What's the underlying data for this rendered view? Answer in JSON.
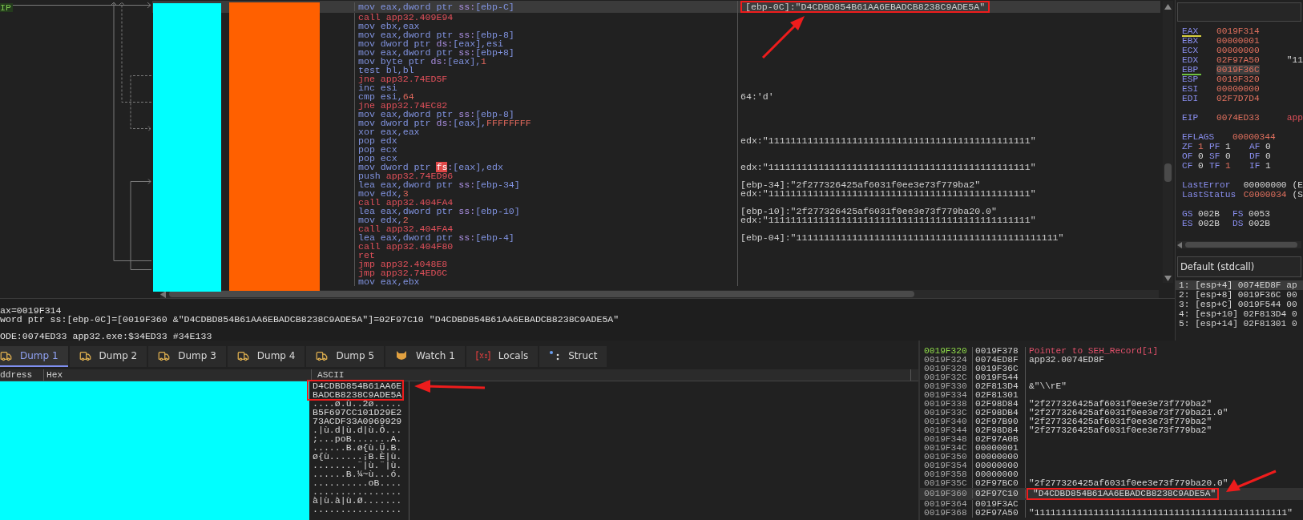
{
  "disassembly": {
    "eip_label": "IP",
    "rows": [
      {
        "mnemonic": "mov",
        "kind": "plain",
        "operands": [
          {
            "text": "eax,dword ptr ",
            "kind": "reg"
          },
          {
            "text": "ss:",
            "kind": "seg"
          },
          {
            "text": "[ebp-C]",
            "kind": "reg"
          }
        ],
        "comment": "[ebp-0C]:\"D4CDBD854B61AA6EBADCB8238C9ADE5A\"",
        "highlighted": true,
        "selected": true
      },
      {
        "mnemonic": "call",
        "kind": "branch",
        "operands": [
          {
            "text": "app32.409E94",
            "kind": "addr"
          }
        ],
        "highlighted": false,
        "selected": false
      },
      {
        "mnemonic": "mov",
        "kind": "plain",
        "operands": [
          {
            "text": "ebx,eax",
            "kind": "reg"
          }
        ],
        "highlighted": false,
        "selected": false
      },
      {
        "mnemonic": "mov",
        "kind": "plain",
        "operands": [
          {
            "text": "eax,dword ptr ",
            "kind": "reg"
          },
          {
            "text": "ss:",
            "kind": "seg"
          },
          {
            "text": "[ebp-8]",
            "kind": "reg"
          }
        ],
        "highlighted": false,
        "selected": false
      },
      {
        "mnemonic": "mov",
        "kind": "plain",
        "operands": [
          {
            "text": "dword ptr ",
            "kind": "reg"
          },
          {
            "text": "ds:",
            "kind": "seg"
          },
          {
            "text": "[eax],esi",
            "kind": "reg"
          }
        ],
        "highlighted": false,
        "selected": false
      },
      {
        "mnemonic": "mov",
        "kind": "plain",
        "operands": [
          {
            "text": "eax,dword ptr ",
            "kind": "reg"
          },
          {
            "text": "ss:",
            "kind": "seg"
          },
          {
            "text": "[ebp+8]",
            "kind": "reg"
          }
        ],
        "highlighted": false,
        "selected": false
      },
      {
        "mnemonic": "mov",
        "kind": "plain",
        "operands": [
          {
            "text": "byte ptr ",
            "kind": "reg"
          },
          {
            "text": "ds:",
            "kind": "seg"
          },
          {
            "text": "[eax],",
            "kind": "reg"
          },
          {
            "text": "1",
            "kind": "imm"
          }
        ],
        "highlighted": false,
        "selected": false
      },
      {
        "mnemonic": "test",
        "kind": "plain",
        "operands": [
          {
            "text": "bl,bl",
            "kind": "reg"
          }
        ],
        "highlighted": false,
        "selected": false
      },
      {
        "mnemonic": "jne",
        "kind": "branch",
        "operands": [
          {
            "text": "app32.74ED5F",
            "kind": "addr"
          }
        ],
        "highlighted": false,
        "selected": false
      },
      {
        "mnemonic": "inc",
        "kind": "plain",
        "operands": [
          {
            "text": "esi",
            "kind": "reg"
          }
        ],
        "highlighted": false,
        "selected": false
      },
      {
        "mnemonic": "cmp",
        "kind": "plain",
        "operands": [
          {
            "text": "esi,",
            "kind": "reg"
          },
          {
            "text": "64",
            "kind": "imm"
          }
        ],
        "comment": "64:'d'",
        "highlighted": false,
        "selected": false
      },
      {
        "mnemonic": "jne",
        "kind": "branch",
        "operands": [
          {
            "text": "app32.74EC82",
            "kind": "addr"
          }
        ],
        "highlighted": false,
        "selected": false
      },
      {
        "mnemonic": "mov",
        "kind": "plain",
        "operands": [
          {
            "text": "eax,dword ptr ",
            "kind": "reg"
          },
          {
            "text": "ss:",
            "kind": "seg"
          },
          {
            "text": "[ebp-8]",
            "kind": "reg"
          }
        ],
        "highlighted": false,
        "selected": false
      },
      {
        "mnemonic": "mov",
        "kind": "plain",
        "operands": [
          {
            "text": "dword ptr ",
            "kind": "reg"
          },
          {
            "text": "ds:",
            "kind": "seg"
          },
          {
            "text": "[eax],",
            "kind": "reg"
          },
          {
            "text": "FFFFFFFF",
            "kind": "imm"
          }
        ],
        "highlighted": false,
        "selected": false
      },
      {
        "mnemonic": "xor",
        "kind": "plain",
        "operands": [
          {
            "text": "eax,eax",
            "kind": "reg"
          }
        ],
        "highlighted": false,
        "selected": false
      },
      {
        "mnemonic": "pop",
        "kind": "plain",
        "operands": [
          {
            "text": "edx",
            "kind": "reg"
          }
        ],
        "comment": "edx:\"11111111111111111111111111111111111111111111111\"",
        "highlighted": false,
        "selected": false
      },
      {
        "mnemonic": "pop",
        "kind": "plain",
        "operands": [
          {
            "text": "ecx",
            "kind": "reg"
          }
        ],
        "highlighted": false,
        "selected": false
      },
      {
        "mnemonic": "pop",
        "kind": "plain",
        "operands": [
          {
            "text": "ecx",
            "kind": "reg"
          }
        ],
        "highlighted": false,
        "selected": false
      },
      {
        "mnemonic": "mov",
        "kind": "plain",
        "operands": [
          {
            "text": "dword ptr ",
            "kind": "reg"
          },
          {
            "text": "fs",
            "kind": "hl"
          },
          {
            "text": ":",
            "kind": "seg"
          },
          {
            "text": "[eax],edx",
            "kind": "reg"
          }
        ],
        "comment": "edx:\"11111111111111111111111111111111111111111111111\"",
        "highlighted": false,
        "selected": false
      },
      {
        "mnemonic": "push",
        "kind": "plain",
        "operands": [
          {
            "text": "app32.74ED96",
            "kind": "addr"
          }
        ],
        "highlighted": false,
        "selected": false
      },
      {
        "mnemonic": "lea",
        "kind": "plain",
        "operands": [
          {
            "text": "eax,dword ptr ",
            "kind": "reg"
          },
          {
            "text": "ss:",
            "kind": "seg"
          },
          {
            "text": "[ebp-34]",
            "kind": "reg"
          }
        ],
        "comment": "[ebp-34]:\"2f277326425af6031f0ee3e73f779ba2\"",
        "highlighted": false,
        "selected": false
      },
      {
        "mnemonic": "mov",
        "kind": "plain",
        "operands": [
          {
            "text": "edx,",
            "kind": "reg"
          },
          {
            "text": "3",
            "kind": "imm"
          }
        ],
        "comment": "edx:\"11111111111111111111111111111111111111111111111\"",
        "highlighted": false,
        "selected": false
      },
      {
        "mnemonic": "call",
        "kind": "branch",
        "operands": [
          {
            "text": "app32.404FA4",
            "kind": "addr"
          }
        ],
        "highlighted": false,
        "selected": false
      },
      {
        "mnemonic": "lea",
        "kind": "plain",
        "operands": [
          {
            "text": "eax,dword ptr ",
            "kind": "reg"
          },
          {
            "text": "ss:",
            "kind": "seg"
          },
          {
            "text": "[ebp-10]",
            "kind": "reg"
          }
        ],
        "comment": "[ebp-10]:\"2f277326425af6031f0ee3e73f779ba20.0\"",
        "highlighted": false,
        "selected": false
      },
      {
        "mnemonic": "mov",
        "kind": "plain",
        "operands": [
          {
            "text": "edx,",
            "kind": "reg"
          },
          {
            "text": "2",
            "kind": "imm"
          }
        ],
        "comment": "edx:\"11111111111111111111111111111111111111111111111\"",
        "highlighted": false,
        "selected": false
      },
      {
        "mnemonic": "call",
        "kind": "branch",
        "operands": [
          {
            "text": "app32.404FA4",
            "kind": "addr"
          }
        ],
        "highlighted": false,
        "selected": false
      },
      {
        "mnemonic": "lea",
        "kind": "plain",
        "operands": [
          {
            "text": "eax,dword ptr ",
            "kind": "reg"
          },
          {
            "text": "ss:",
            "kind": "seg"
          },
          {
            "text": "[ebp-4]",
            "kind": "reg"
          }
        ],
        "comment": "[ebp-04]:\"11111111111111111111111111111111111111111111111\"",
        "highlighted": false,
        "selected": false
      },
      {
        "mnemonic": "call",
        "kind": "branch",
        "operands": [
          {
            "text": "app32.404F80",
            "kind": "addr"
          }
        ],
        "highlighted": false,
        "selected": false
      },
      {
        "mnemonic": "ret",
        "kind": "branch",
        "operands": [],
        "highlighted": false,
        "selected": false
      },
      {
        "mnemonic": "jmp",
        "kind": "branch",
        "operands": [
          {
            "text": "app32.4048E8",
            "kind": "addr"
          }
        ],
        "highlighted": false,
        "selected": false
      },
      {
        "mnemonic": "jmp",
        "kind": "branch",
        "operands": [
          {
            "text": "app32.74ED6C",
            "kind": "addr"
          }
        ],
        "highlighted": false,
        "selected": false
      },
      {
        "mnemonic": "mov",
        "kind": "plain",
        "operands": [
          {
            "text": "eax,ebx",
            "kind": "reg"
          }
        ],
        "highlighted": false,
        "selected": false
      }
    ]
  },
  "info_lines": [
    "ax=0019F314",
    "word ptr ss:[ebp-0C]=[0019F360 &\"D4CDBD854B61AA6EBADCB8238C9ADE5A\"]=02F97C10 \"D4CDBD854B61AA6EBADCB8238C9ADE5A\"",
    "ODE:0074ED33 app32.exe:$34ED33 #34E133"
  ],
  "registers": {
    "general": [
      {
        "name": "EAX",
        "value": "0019F314",
        "changed": true,
        "selected": false,
        "color": "#d8d040"
      },
      {
        "name": "EBX",
        "value": "00000001",
        "changed": true,
        "selected": false
      },
      {
        "name": "ECX",
        "value": "00000000",
        "changed": true,
        "selected": false
      },
      {
        "name": "EDX",
        "value": "02F97A50",
        "note": "\"11",
        "changed": true,
        "selected": false
      },
      {
        "name": "EBP",
        "value": "0019F36C",
        "changed": true,
        "selected": true,
        "color": "#6ec040"
      },
      {
        "name": "ESP",
        "value": "0019F320",
        "changed": true,
        "selected": false
      },
      {
        "name": "ESI",
        "value": "00000000",
        "changed": true,
        "selected": false
      },
      {
        "name": "EDI",
        "value": "02F7D7D4",
        "changed": true,
        "selected": false
      }
    ],
    "eip": {
      "name": "EIP",
      "value": "0074ED33",
      "note": "app"
    },
    "eflags": {
      "name": "EFLAGS",
      "value": "00000344"
    },
    "flags": [
      [
        {
          "name": "ZF",
          "value": "1",
          "changed": true
        },
        {
          "name": "PF",
          "value": "1",
          "changed": false
        },
        {
          "name": "AF",
          "value": "0",
          "changed": false
        }
      ],
      [
        {
          "name": "OF",
          "value": "0",
          "changed": false
        },
        {
          "name": "SF",
          "value": "0",
          "changed": false
        },
        {
          "name": "DF",
          "value": "0",
          "changed": false
        }
      ],
      [
        {
          "name": "CF",
          "value": "0",
          "changed": false
        },
        {
          "name": "TF",
          "value": "1",
          "changed": true
        },
        {
          "name": "IF",
          "value": "1",
          "changed": false
        }
      ]
    ],
    "last": [
      {
        "name": "LastError",
        "value": "00000000",
        "note": "(E",
        "changed": false
      },
      {
        "name": "LastStatus",
        "value": "C0000034",
        "note": "(S",
        "changed": true
      }
    ],
    "segments": [
      [
        {
          "name": "GS",
          "value": "002B"
        },
        {
          "name": "FS",
          "value": "0053"
        }
      ],
      [
        {
          "name": "ES",
          "value": "002B"
        },
        {
          "name": "DS",
          "value": "002B"
        }
      ]
    ]
  },
  "call_stack": {
    "title": "Default (stdcall)",
    "rows": [
      {
        "text": "1: [esp+4] 0074ED8F ap",
        "selected": true
      },
      {
        "text": "2: [esp+8] 0019F36C 00",
        "selected": false
      },
      {
        "text": "3: [esp+C] 0019F544 00",
        "selected": false
      },
      {
        "text": "4: [esp+10] 02F813D4 0",
        "selected": false
      },
      {
        "text": "5: [esp+14] 02F81301 0",
        "selected": false
      }
    ]
  },
  "tabs": [
    {
      "label": "Dump 1",
      "kind": "dump",
      "selected": true
    },
    {
      "label": "Dump 2",
      "kind": "dump",
      "selected": false
    },
    {
      "label": "Dump 3",
      "kind": "dump",
      "selected": false
    },
    {
      "label": "Dump 4",
      "kind": "dump",
      "selected": false
    },
    {
      "label": "Dump 5",
      "kind": "dump",
      "selected": false
    },
    {
      "label": "Watch 1",
      "kind": "watch",
      "selected": false
    },
    {
      "label": "Locals",
      "kind": "locals",
      "selected": false
    },
    {
      "label": "Struct",
      "kind": "struct",
      "selected": false
    }
  ],
  "dump": {
    "columns": [
      "ddress",
      "Hex",
      "ASCII"
    ],
    "ascii_rows": [
      {
        "text": "D4CDBD854B61AA6E",
        "highlighted": true
      },
      {
        "text": "BADCB8238C9ADE5A",
        "highlighted": true
      },
      {
        "text": "....ø.ù..2ø.....",
        "highlighted": false
      },
      {
        "text": "B5F697CC101D29E2",
        "highlighted": false
      },
      {
        "text": "73ACDF33A0969929",
        "highlighted": false
      },
      {
        "text": ".|ù.d|ù.d|ù.Ô...",
        "highlighted": false
      },
      {
        "text": ";...poB.......A.",
        "highlighted": false
      },
      {
        "text": "......B.ø{ù.Ü.B.",
        "highlighted": false
      },
      {
        "text": "ø{ù......¡B.È|ù.",
        "highlighted": false
      },
      {
        "text": "........¨|ù.¨|ù.",
        "highlighted": false
      },
      {
        "text": "......B.¼~ù...ó.",
        "highlighted": false
      },
      {
        "text": "..........oB....",
        "highlighted": false
      },
      {
        "text": "................",
        "highlighted": false
      },
      {
        "text": "à|ù.à|ù.Ø.......",
        "highlighted": false
      },
      {
        "text": "................",
        "highlighted": false
      }
    ]
  },
  "stack": {
    "rows": [
      {
        "address": "0019F320",
        "value": "0019F378",
        "comment": "Pointer to SEH_Record[1]",
        "kind": "seh",
        "current": true,
        "highlighted": false,
        "selected": false
      },
      {
        "address": "0019F324",
        "value": "0074ED8F",
        "comment": "app32.0074ED8F",
        "kind": "plain",
        "current": false,
        "highlighted": false,
        "selected": false
      },
      {
        "address": "0019F328",
        "value": "0019F36C",
        "current": false,
        "highlighted": false,
        "selected": false
      },
      {
        "address": "0019F32C",
        "value": "0019F544",
        "current": false,
        "highlighted": false,
        "selected": false
      },
      {
        "address": "0019F330",
        "value": "02F813D4",
        "comment": "&\"\\\\rE\"",
        "kind": "plain",
        "current": false,
        "highlighted": false,
        "selected": false
      },
      {
        "address": "0019F334",
        "value": "02F81301",
        "current": false,
        "highlighted": false,
        "selected": false
      },
      {
        "address": "0019F338",
        "value": "02F98D84",
        "comment": "\"2f277326425af6031f0ee3e73f779ba2\"",
        "kind": "plain",
        "current": false,
        "highlighted": false,
        "selected": false
      },
      {
        "address": "0019F33C",
        "value": "02F98DB4",
        "comment": "\"2f277326425af6031f0ee3e73f779ba21.0\"",
        "kind": "plain",
        "current": false,
        "highlighted": false,
        "selected": false
      },
      {
        "address": "0019F340",
        "value": "02F97B90",
        "comment": "\"2f277326425af6031f0ee3e73f779ba2\"",
        "kind": "plain",
        "current": false,
        "highlighted": false,
        "selected": false
      },
      {
        "address": "0019F344",
        "value": "02F98D84",
        "comment": "\"2f277326425af6031f0ee3e73f779ba2\"",
        "kind": "plain",
        "current": false,
        "highlighted": false,
        "selected": false
      },
      {
        "address": "0019F348",
        "value": "02F97A0B",
        "current": false,
        "highlighted": false,
        "selected": false
      },
      {
        "address": "0019F34C",
        "value": "00000001",
        "current": false,
        "highlighted": false,
        "selected": false
      },
      {
        "address": "0019F350",
        "value": "00000000",
        "current": false,
        "highlighted": false,
        "selected": false
      },
      {
        "address": "0019F354",
        "value": "00000000",
        "current": false,
        "highlighted": false,
        "selected": false
      },
      {
        "address": "0019F358",
        "value": "00000000",
        "current": false,
        "highlighted": false,
        "selected": false
      },
      {
        "address": "0019F35C",
        "value": "02F97BC0",
        "comment": "\"2f277326425af6031f0ee3e73f779ba20.0\"",
        "kind": "plain",
        "current": false,
        "highlighted": false,
        "selected": false
      },
      {
        "address": "0019F360",
        "value": "02F97C10",
        "comment": "\"D4CDBD854B61AA6EBADCB8238C9ADE5A\"",
        "kind": "plain",
        "current": false,
        "highlighted": true,
        "selected": true
      },
      {
        "address": "0019F364",
        "value": "0019F3AC",
        "current": false,
        "highlighted": false,
        "selected": false
      },
      {
        "address": "0019F368",
        "value": "02F97A50",
        "comment": "\"11111111111111111111111111111111111111111111111\"",
        "kind": "plain",
        "current": false,
        "highlighted": false,
        "selected": false
      }
    ]
  }
}
